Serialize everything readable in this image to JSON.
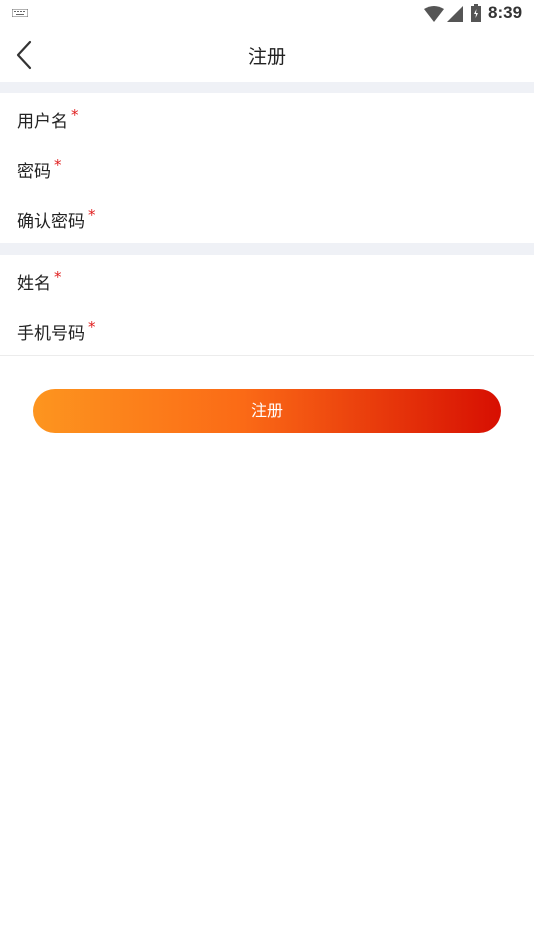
{
  "status_bar": {
    "time": "8:39",
    "icons": [
      "keyboard-icon",
      "wifi-icon",
      "signal-icon",
      "battery-icon"
    ]
  },
  "header": {
    "title": "注册",
    "back_icon": "chevron-left-icon"
  },
  "form": {
    "required_mark": "*",
    "section1": [
      {
        "label": "用户名"
      },
      {
        "label": "密码"
      },
      {
        "label": "确认密码"
      }
    ],
    "section2": [
      {
        "label": "姓名"
      },
      {
        "label": "手机号码"
      }
    ]
  },
  "submit": {
    "label": "注册",
    "gradient": [
      "#fd951f",
      "#d70f02"
    ]
  },
  "colors": {
    "required": "#e02020",
    "section_gap": "#eff1f6"
  }
}
